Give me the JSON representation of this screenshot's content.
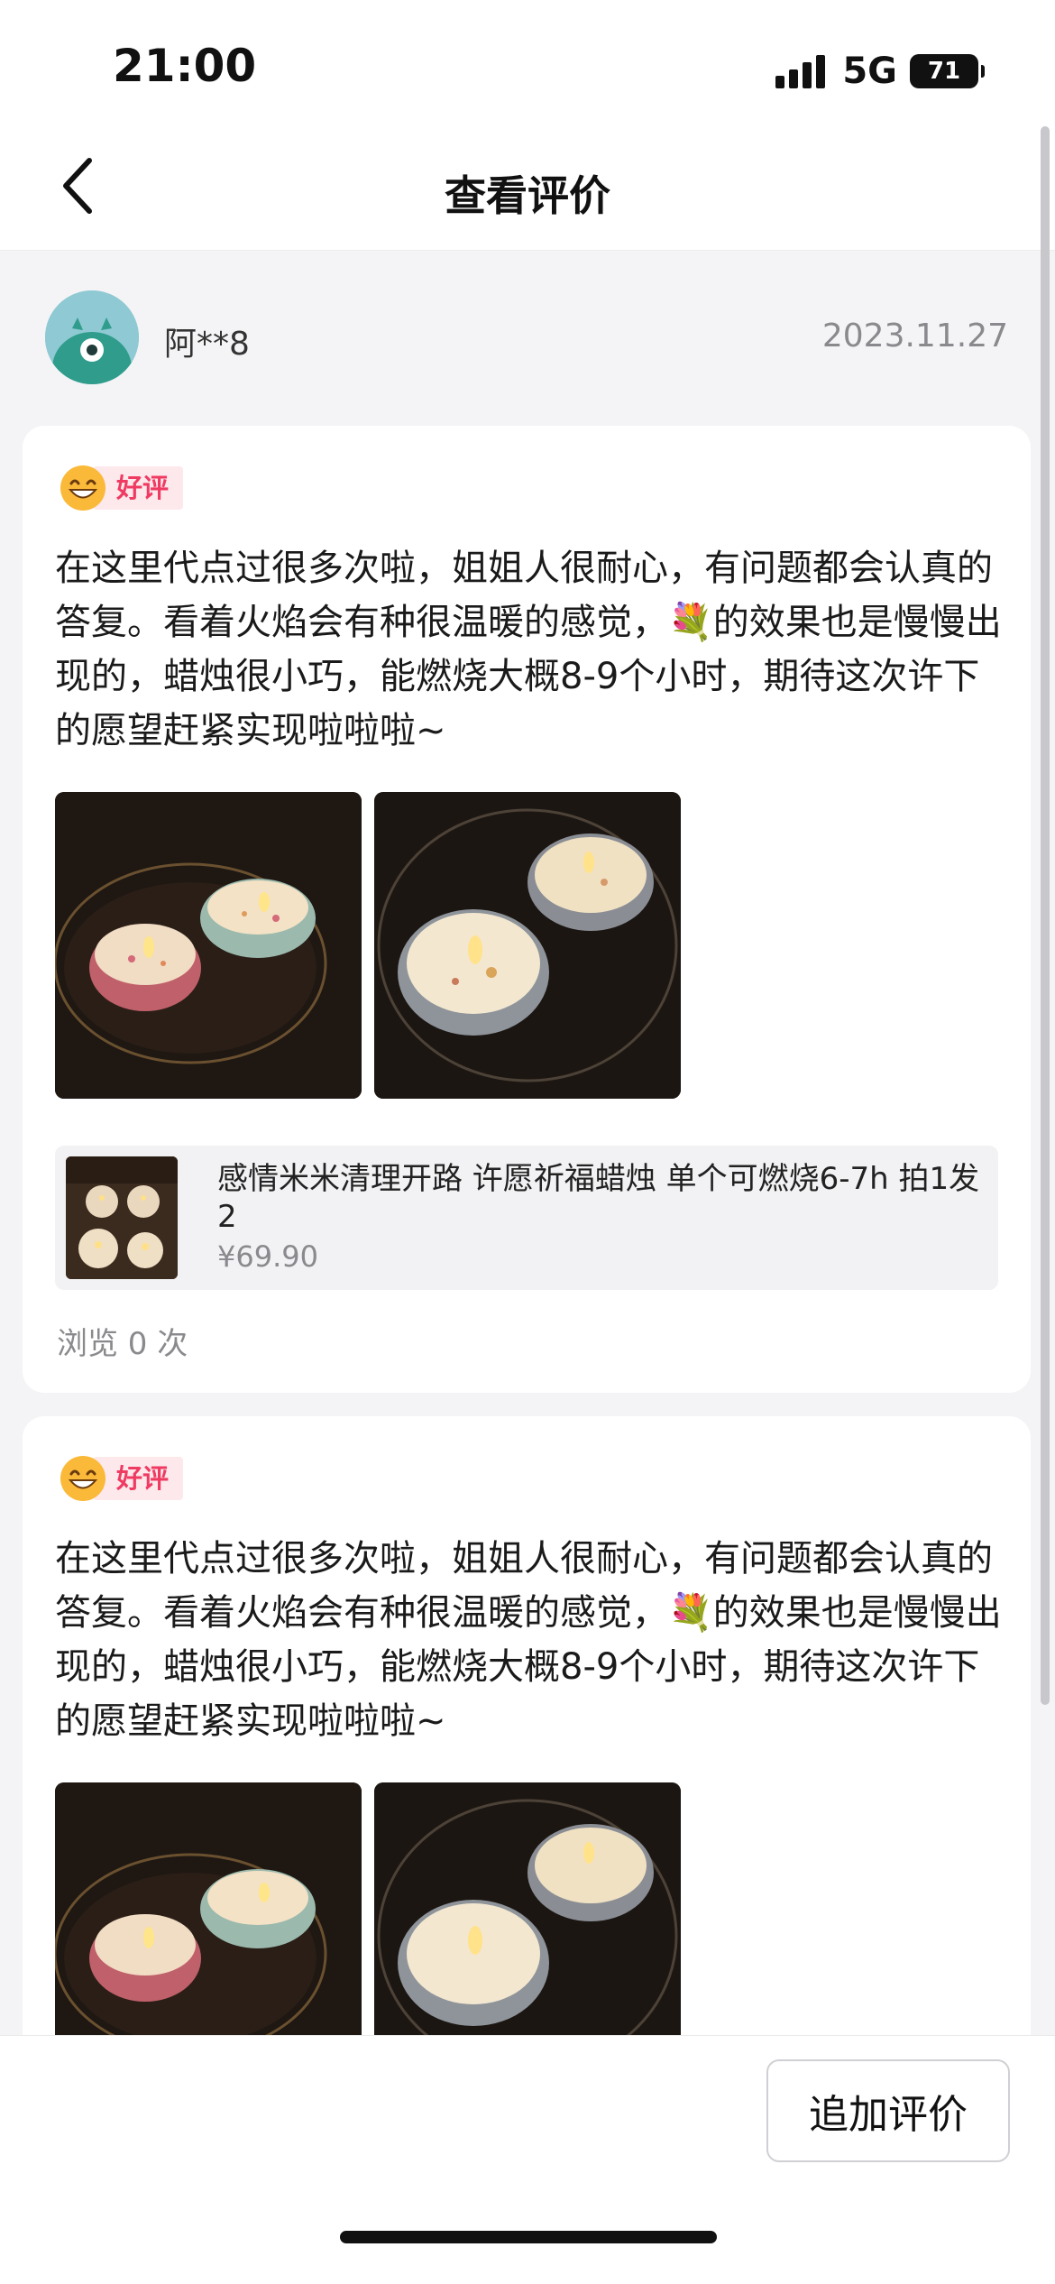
{
  "status_bar": {
    "time": "21:00",
    "network": "5G",
    "battery": "71"
  },
  "nav": {
    "title": "查看评价"
  },
  "user": {
    "name": "阿**8",
    "date": "2023.11.27"
  },
  "reviews": [
    {
      "badge": "好评",
      "text": "在这里代点过很多次啦，姐姐人很耐心，有问题都会认真的答复。看着火焰会有种很温暖的感觉，💐的效果也是慢慢出现的，蜡烛很小巧，能燃烧大概8-9个小时，期待这次许下的愿望赶紧实现啦啦啦~",
      "product": {
        "title": "感情米米清理开路 许愿祈福蜡烛 单个可燃烧6-7h 拍1发2",
        "price": "¥69.90"
      },
      "views": "浏览 0 次"
    },
    {
      "badge": "好评",
      "text": "在这里代点过很多次啦，姐姐人很耐心，有问题都会认真的答复。看着火焰会有种很温暖的感觉，💐的效果也是慢慢出现的，蜡烛很小巧，能燃烧大概8-9个小时，期待这次许下的愿望赶紧实现啦啦啦~"
    }
  ],
  "bottom": {
    "add_review": "追加评价"
  },
  "icons": {
    "back": "chevron-left-icon",
    "signal": "signal-icon",
    "battery": "battery-icon",
    "badge": "smile-face-icon"
  },
  "colors": {
    "badge_text": "#ef3b62",
    "badge_bg": "#fde8ec",
    "avatar_bg": "#8fc9d3"
  }
}
